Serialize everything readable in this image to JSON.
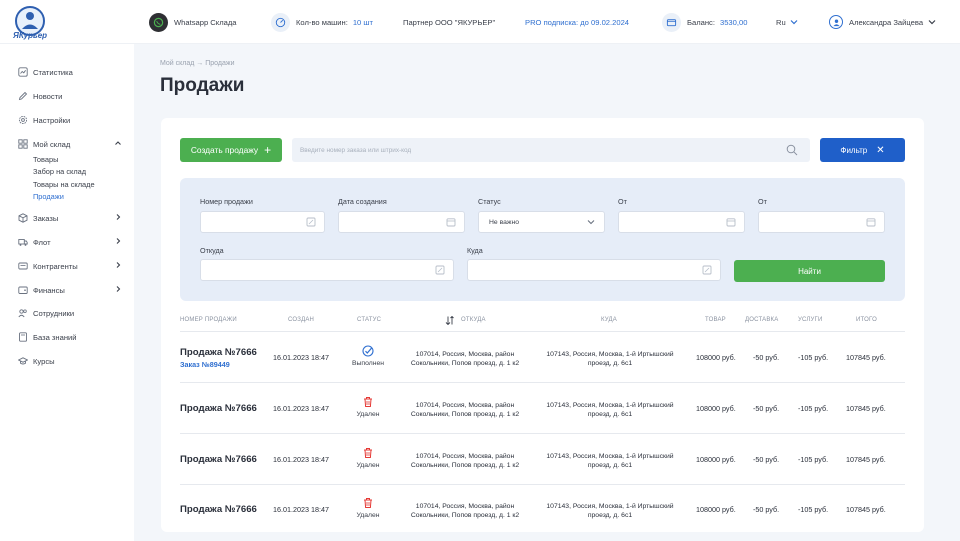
{
  "app": {
    "brand": "ЯКурьер"
  },
  "topbar": {
    "whatsapp": "Whatsapp Склада",
    "cars_label": "Кол-во машин:",
    "cars_value": "10 шт",
    "partner": "Партнер ООО \"ЯКУРЬЕР\"",
    "pro": "PRO подписка: до 09.02.2024",
    "balance_label": "Баланс:",
    "balance_value": "3530,00",
    "lang": "Ru",
    "user": "Александра Зайцева"
  },
  "sidebar": {
    "items": [
      {
        "label": "Статистика"
      },
      {
        "label": "Новости"
      },
      {
        "label": "Настройки"
      },
      {
        "label": "Мой склад"
      },
      {
        "label": "Заказы"
      },
      {
        "label": "Флот"
      },
      {
        "label": "Контрагенты"
      },
      {
        "label": "Финансы"
      },
      {
        "label": "Сотрудники"
      },
      {
        "label": "База знаний"
      },
      {
        "label": "Курсы"
      }
    ],
    "sub": [
      {
        "label": "Товары"
      },
      {
        "label": "Забор на склад"
      },
      {
        "label": "Товары на складе"
      },
      {
        "label": "Продажи"
      }
    ]
  },
  "breadcrumb": "Мой склад  →  Продажи",
  "page_title": "Продажи",
  "toolbar": {
    "create_label": "Создать продажу",
    "search_placeholder": "Введите номер заказа или штрих-код",
    "filter_label": "Фильтр"
  },
  "filters": {
    "sale_number": "Номер продажи",
    "created": "Дата создания",
    "status": "Статус",
    "status_value": "Не важно",
    "from1": "От",
    "from2": "От",
    "where_from": "Откуда",
    "where_to": "Куда",
    "find": "Найти"
  },
  "table": {
    "headers": {
      "number": "НОМЕР ПРОДАЖИ",
      "created": "СОЗДАН",
      "status": "СТАТУС",
      "from": "ОТКУДА",
      "to": "КУДА",
      "goods": "ТОВАР",
      "delivery": "ДОСТАВКА",
      "services": "УСЛУГИ",
      "total": "ИТОГО"
    },
    "rows": [
      {
        "name": "Продажа №7666",
        "order": "Заказ №89449",
        "date": "16.01.2023 18:47",
        "status": "Выполнен",
        "from": "107014, Россия, Москва, район Сокольники, Попов проезд, д. 1 к2",
        "to": "107143, Россия, Москва, 1-й Иртышский проезд, д. 6с1",
        "goods": "108000 руб.",
        "delivery": "-50 руб.",
        "services": "-105 руб.",
        "total": "107845 руб."
      },
      {
        "name": "Продажа №7666",
        "order": "",
        "date": "16.01.2023 18:47",
        "status": "Удален",
        "from": "107014, Россия, Москва, район Сокольники, Попов проезд, д. 1 к2",
        "to": "107143, Россия, Москва, 1-й Иртышский проезд, д. 6с1",
        "goods": "108000 руб.",
        "delivery": "-50 руб.",
        "services": "-105 руб.",
        "total": "107845 руб."
      },
      {
        "name": "Продажа №7666",
        "order": "",
        "date": "16.01.2023 18:47",
        "status": "Удален",
        "from": "107014, Россия, Москва, район Сокольники, Попов проезд, д. 1 к2",
        "to": "107143, Россия, Москва, 1-й Иртышский проезд, д. 6с1",
        "goods": "108000 руб.",
        "delivery": "-50 руб.",
        "services": "-105 руб.",
        "total": "107845 руб."
      },
      {
        "name": "Продажа №7666",
        "order": "",
        "date": "16.01.2023 18:47",
        "status": "Удален",
        "from": "107014, Россия, Москва, район Сокольники, Попов проезд, д. 1 к2",
        "to": "107143, Россия, Москва, 1-й Иртышский проезд, д. 6с1",
        "goods": "108000 руб.",
        "delivery": "-50 руб.",
        "services": "-105 руб.",
        "total": "107845 руб."
      }
    ]
  },
  "colors": {
    "primary": "#1f5fc9",
    "success": "#4caf50",
    "danger": "#e53935",
    "link": "#2f6fd0"
  }
}
